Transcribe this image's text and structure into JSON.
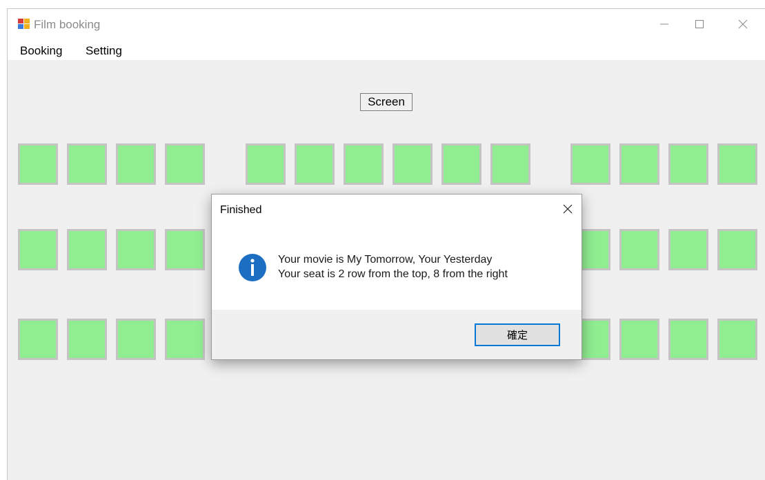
{
  "window": {
    "title": "Film booking",
    "controls": {
      "minimize": "—",
      "maximize": "☐",
      "close": "✕"
    }
  },
  "menu": [
    {
      "label": "Booking"
    },
    {
      "label": "Setting"
    }
  ],
  "screen_label": "Screen",
  "seating": {
    "seat_color": "#90ee90",
    "seat_border_color": "#c4c4c4",
    "rows": [
      {
        "left_block": 4,
        "middle_block": 6,
        "right_block": 4
      },
      {
        "left_block": 4,
        "middle_block": 6,
        "right_block": 4
      },
      {
        "left_block": 4,
        "middle_block": 6,
        "right_block": 4
      }
    ]
  },
  "dialog": {
    "title": "Finished",
    "icon": "info-icon",
    "line1": "Your movie is My Tomorrow, Your Yesterday",
    "line2": "Your seat is 2 row from the top, 8 from the right",
    "ok_label": "確定",
    "accent": "#0078d7"
  }
}
